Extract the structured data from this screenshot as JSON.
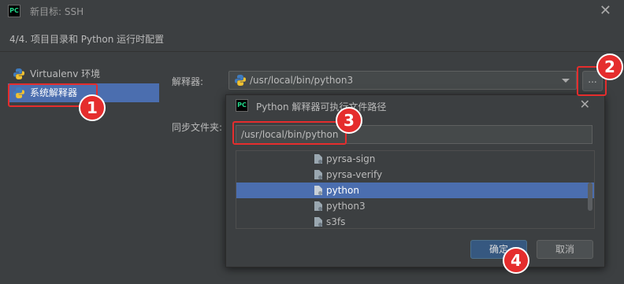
{
  "window": {
    "title": "新目标: SSH",
    "app_logo": "PC",
    "close_glyph": "✕"
  },
  "step": "4/4. 项目目录和 Python 运行时配置",
  "sidebar": {
    "items": [
      {
        "label": "Virtualenv 环境",
        "icon": "python-icon"
      },
      {
        "label": "系统解释器",
        "icon": "python-icon"
      }
    ]
  },
  "form": {
    "interpreter_label": "解释器:",
    "interpreter_value": "/usr/local/bin/python3",
    "browse_label": "...",
    "sync_label": "同步文件夹:"
  },
  "popup": {
    "title": "Python 解释器可执行文件路径",
    "logo": "PC",
    "close_glyph": "✕",
    "path_value": "/usr/local/bin/python",
    "files": [
      {
        "name": "pyrsa-sign"
      },
      {
        "name": "pyrsa-verify"
      },
      {
        "name": "python"
      },
      {
        "name": "python3"
      },
      {
        "name": "s3fs"
      }
    ],
    "ok_label": "确定",
    "cancel_label": "取消"
  },
  "markers": [
    "1",
    "2",
    "3",
    "4"
  ],
  "colors": {
    "background": "#3c3f41",
    "selection": "#4b6eaf",
    "highlight": "#e52d2d",
    "ok_button": "#365880"
  }
}
